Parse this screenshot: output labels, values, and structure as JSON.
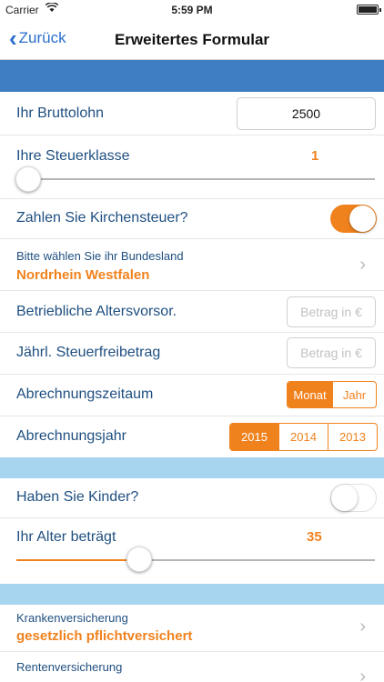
{
  "status_bar": {
    "carrier": "Carrier",
    "time": "5:59 PM"
  },
  "nav": {
    "back_label": "Zurück",
    "title": "Erweitertes Formular"
  },
  "form": {
    "bruttolohn": {
      "label": "Ihr Bruttolohn",
      "value": "2500"
    },
    "steuerklasse": {
      "label": "Ihre Steuerklasse",
      "value": "1",
      "slider_fraction": 0.0
    },
    "kirchensteuer": {
      "label": "Zahlen Sie Kirchensteuer?",
      "on": true
    },
    "bundesland": {
      "hint": "Bitte wählen Sie ihr Bundesland",
      "value": "Nordrhein Westfalen"
    },
    "altersvorsorge": {
      "label": "Betriebliche Altersvorsor.",
      "placeholder": "Betrag in €"
    },
    "steuerfreibetrag": {
      "label": "Jährl. Steuerfreibetrag",
      "placeholder": "Betrag in €"
    },
    "abrechnungszeitraum": {
      "label": "Abrechnungszeitaum",
      "options": [
        "Monat",
        "Jahr"
      ],
      "selected": "Monat"
    },
    "abrechnungsjahr": {
      "label": "Abrechnungsjahr",
      "options": [
        "2015",
        "2014",
        "2013"
      ],
      "selected": "2015"
    },
    "kinder": {
      "label": "Haben Sie Kinder?",
      "on": false
    },
    "alter": {
      "label": "Ihr Alter beträgt",
      "value": "35",
      "slider_fraction": 0.34
    },
    "krankenversicherung": {
      "hint": "Krankenversicherung",
      "value": "gesetzlich pflichtversichert"
    },
    "rentenversicherung": {
      "hint": "Rentenversicherung"
    }
  },
  "colors": {
    "accent": "#f0821e",
    "header_blue": "#3f7ec3",
    "section_light": "#a7d4ee",
    "label_blue": "#1f4f80",
    "link_blue": "#2b6fce"
  },
  "icons": {
    "back": "chevron-left-icon",
    "disclosure": "chevron-right-icon",
    "wifi": "wifi-icon",
    "battery": "battery-icon"
  }
}
